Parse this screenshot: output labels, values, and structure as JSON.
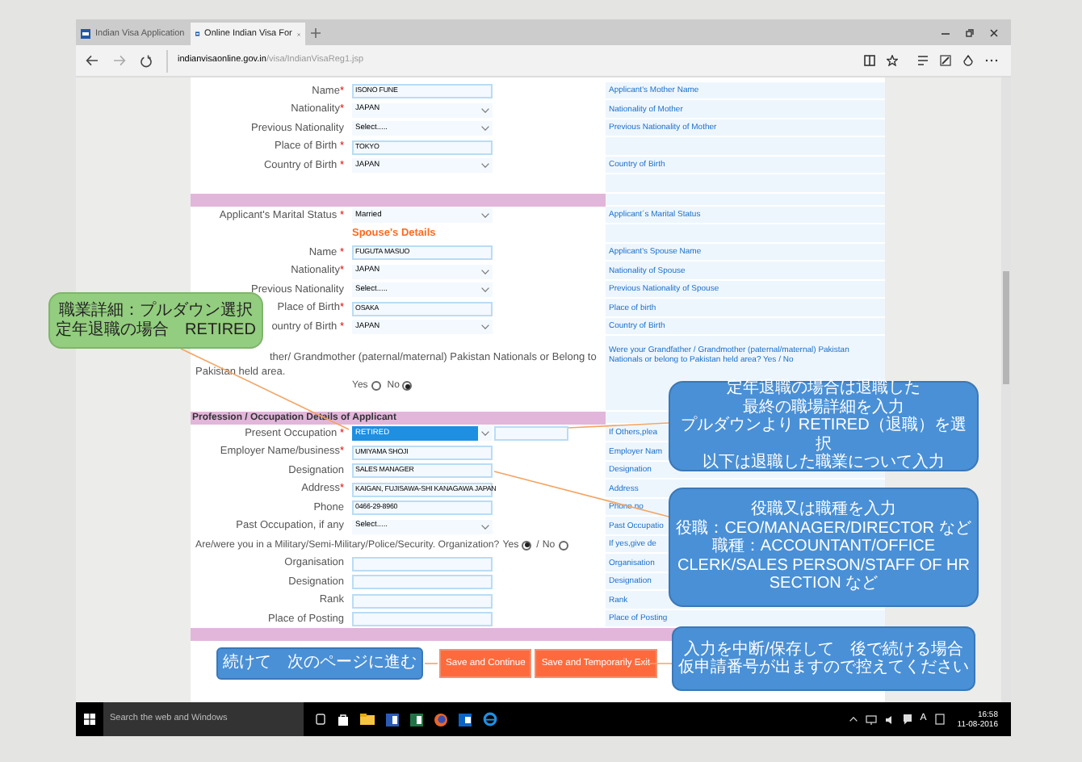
{
  "browser": {
    "tabs": [
      {
        "title": "Indian Visa Application",
        "selected": false
      },
      {
        "title": "Online Indian Visa For",
        "selected": true
      }
    ],
    "url": {
      "host": "indianvisaonline.gov.in",
      "path": "/visa/IndianVisaReg1.jsp"
    }
  },
  "form": {
    "rows": [
      {
        "kind": "input",
        "label": "Name",
        "required_mark": "*",
        "value": "ISONO FUNE",
        "help": "Applicant's Mother Name"
      },
      {
        "kind": "select",
        "label": "Nationality",
        "required_mark": "*",
        "value": "JAPAN",
        "help": "Nationality of Mother"
      },
      {
        "kind": "select",
        "label": "Previous Nationality",
        "value": "Select.....",
        "help": "Previous Nationality of Mother"
      },
      {
        "kind": "input",
        "label": "Place of Birth",
        "required_mark": " *",
        "value": "TOKYO"
      },
      {
        "kind": "select",
        "label": "Country of Birth",
        "required_mark": " *",
        "value": "JAPAN",
        "help": "Country of Birth"
      },
      {
        "kind": "blank"
      },
      {
        "kind": "bar"
      },
      {
        "kind": "select",
        "label": "Applicant's Marital Status",
        "required_mark": " *",
        "value": "Married",
        "help": "Applicant´s Marital Status"
      },
      {
        "kind": "subheading",
        "text": "Spouse's Details"
      },
      {
        "kind": "input",
        "label": "Name",
        "required_mark": " *",
        "value": "FUGUTA MASUO",
        "help": "Applicant's Spouse Name"
      },
      {
        "kind": "select",
        "label": "Nationality",
        "required_mark": "*",
        "value": "JAPAN",
        "help": "Nationality of Spouse"
      },
      {
        "kind": "select",
        "label": "Previous Nationality",
        "value": "Select.....",
        "help": "Previous Nationality of Spouse"
      },
      {
        "kind": "input",
        "label": "Place of Birth",
        "required_mark": "*",
        "value": "OSAKA",
        "help": "Place of birth"
      },
      {
        "kind": "select",
        "label": "ountry of Birth",
        "required_mark": " *",
        "value": "JAPAN",
        "help": "Country of Birth"
      },
      {
        "kind": "question",
        "text": "ther/ Grandmother (paternal/maternal) Pakistan Nationals or Belong to Pakistan held area.",
        "help": "Were your Grandfather / Grandmother (paternal/maternal) Pakistan Nationals or belong to Pakistan held area? Yes / No"
      },
      {
        "kind": "radio_row",
        "options": [
          {
            "label": "Yes",
            "selected": false
          },
          {
            "label": "No",
            "selected": true
          }
        ]
      },
      {
        "kind": "bar",
        "text": "Profession / Occupation Details of Applicant"
      },
      {
        "kind": "select_other",
        "label": "Present Occupation",
        "required_mark": " *",
        "value": "RETIRED",
        "focused": true,
        "help": "If Others,plea"
      },
      {
        "kind": "input",
        "label": "Employer Name/business",
        "required_mark": "*",
        "value": "UMIYAMA SHOJI",
        "help": "Employer Nam"
      },
      {
        "kind": "input",
        "label": "Designation",
        "value": "SALES MANAGER",
        "help": "Designation"
      },
      {
        "kind": "input",
        "label": "Address",
        "required_mark": "*",
        "value": "KAIGAN, FUJISAWA-SHI KANAGAWA JAPAN",
        "help": "Address"
      },
      {
        "kind": "input",
        "label": "Phone",
        "value": "0466-29-8960",
        "help": "Phone no"
      },
      {
        "kind": "select",
        "label": "Past Occupation, if any",
        "value": "Select.....",
        "help": "Past Occupatio"
      },
      {
        "kind": "inline_question",
        "text": "Are/were you in a Military/Semi-Military/Police/Security. Organization?",
        "separator": "/",
        "options": [
          {
            "label": "Yes",
            "selected": true
          },
          {
            "label": "No",
            "selected": false
          }
        ],
        "help": "If yes,give de"
      },
      {
        "kind": "input",
        "label": "Organisation",
        "help": "Organisation"
      },
      {
        "kind": "input",
        "label": "Designation",
        "help": "Designation"
      },
      {
        "kind": "input",
        "label": "Rank",
        "help": "Rank"
      },
      {
        "kind": "input",
        "label": "Place of Posting",
        "help": "Place of Posting"
      },
      {
        "kind": "bar_full"
      }
    ],
    "buttons": [
      "Save and Continue",
      "Save and Temporarily Exit"
    ]
  },
  "callouts": [
    {
      "lines": [
        "職業詳細：プルダウン選択",
        "定年退職の場合　RETIRED"
      ],
      "color": "#93cd7f"
    },
    {
      "lines": [
        "定年退職の場合は退職した",
        "最終の職場詳細を入力",
        "プルダウンより RETIRED（退職）を選択",
        "以下は退職した職業について入力"
      ],
      "color": "#4a90d6"
    },
    {
      "lines": [
        "役職又は職種を入力",
        "役職：CEO/MANAGER/DIRECTOR など",
        "職種：ACCOUNTANT/OFFICE CLERK/SALES PERSON/STAFF OF HR SECTION など"
      ],
      "color": "#4a90d6"
    },
    {
      "lines": [
        "続けて　次のページに進む"
      ],
      "color": "#4a90d6"
    },
    {
      "lines": [
        "入力を中断/保存して　後で続ける場合",
        "仮申請番号が出ますので控えてください"
      ],
      "color": "#4a90d6"
    }
  ],
  "taskbar": {
    "search_placeholder": "Search the web and Windows",
    "input_indicator": "A",
    "time": "16:58",
    "date": "11-08-2016"
  }
}
